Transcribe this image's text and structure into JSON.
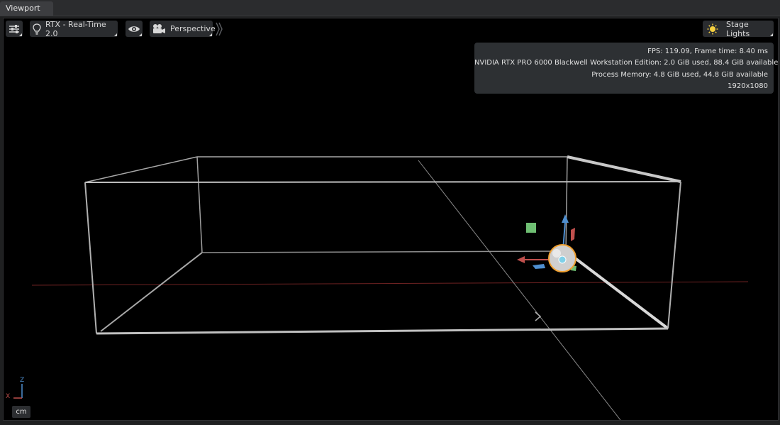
{
  "window": {
    "tab_label": "Viewport"
  },
  "toolbar": {
    "settings_icon": "sliders-icon",
    "renderer_icon": "lightbulb-icon",
    "renderer_label": "RTX - Real-Time 2.0",
    "visibility_icon": "eye-icon",
    "camera_icon": "movie-camera-icon",
    "camera_label": "Perspective",
    "expand_icon": "double-chevron-right-icon",
    "lighting_icon": "sun-icon",
    "lighting_label": "Stage Lights"
  },
  "stats": {
    "fps_line": "FPS: 119.09, Frame time: 8.40 ms",
    "gpu_line": "NVIDIA RTX PRO 6000 Blackwell Workstation Edition: 2.0 GiB used, 88.4 GiB available",
    "memory_line": "Process Memory: 4.8 GiB used, 44.8 GiB available",
    "resolution_line": "1920x1080"
  },
  "axis_gizmo": {
    "z_label": "Z",
    "x_label": "X"
  },
  "units": {
    "label": "cm"
  },
  "colors": {
    "x_axis": "#c0504d",
    "y_axis": "#6fbf73",
    "z_axis": "#4f8fd0",
    "selection": "#f0a030",
    "accent_sun": "#f5d040"
  }
}
